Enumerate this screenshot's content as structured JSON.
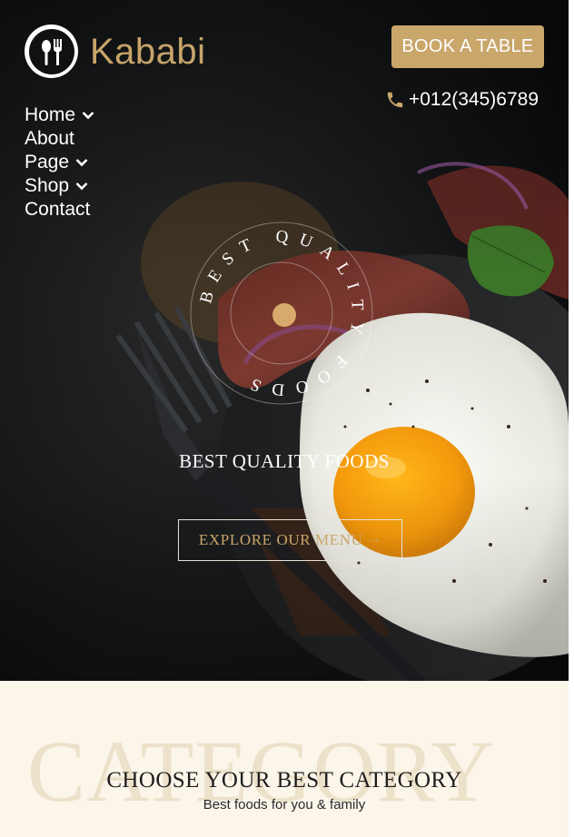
{
  "brand": {
    "name": "Kababi",
    "accent_color": "#c9a66a",
    "logo_icon": "fork-spoon-icon"
  },
  "header": {
    "book_button_label": "BOOK A TABLE",
    "phone": "+012(345)6789",
    "phone_icon": "phone-icon"
  },
  "nav": {
    "items": [
      {
        "label": "Home",
        "has_dropdown": true
      },
      {
        "label": "About",
        "has_dropdown": false
      },
      {
        "label": "Page",
        "has_dropdown": true
      },
      {
        "label": "Shop",
        "has_dropdown": true
      },
      {
        "label": "Contact",
        "has_dropdown": false
      }
    ]
  },
  "hero": {
    "badge_text": "BEST QUALITY FOODS",
    "title": "BEST QUALITY FOODS",
    "cta_label": "EXPLORE OUR MENU",
    "cta_icon": "arrow-right-icon"
  },
  "category": {
    "background_word": "CATEGORY",
    "title": "CHOOSE YOUR BEST CATEGORY",
    "subtitle": "Best foods for you & family"
  }
}
